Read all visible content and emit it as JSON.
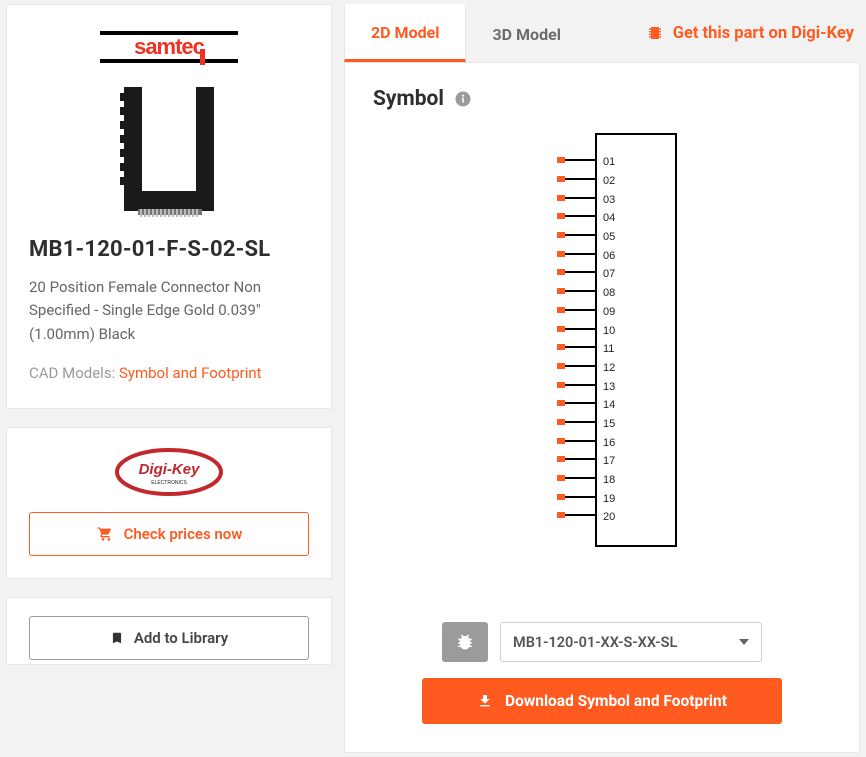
{
  "left": {
    "brand": "samtec",
    "part_name": "MB1-120-01-F-S-02-SL",
    "description": "20 Position Female Connector Non Specified - Single Edge Gold 0.039\" (1.00mm) Black",
    "cad_label": "CAD Models:",
    "cad_link": "Symbol and Footprint",
    "check_prices": "Check prices now",
    "add_to_library": "Add to Library"
  },
  "tabs": {
    "tab1": "2D Model",
    "tab2": "3D Model",
    "dk_link": "Get this part on Digi-Key"
  },
  "viewer": {
    "title": "Symbol",
    "pins": [
      "01",
      "02",
      "03",
      "04",
      "05",
      "06",
      "07",
      "08",
      "09",
      "10",
      "11",
      "12",
      "13",
      "14",
      "15",
      "16",
      "17",
      "18",
      "19",
      "20"
    ],
    "select_value": "MB1-120-01-XX-S-XX-SL",
    "download_label": "Download Symbol and Footprint"
  },
  "colors": {
    "accent": "#ff5a1f"
  }
}
